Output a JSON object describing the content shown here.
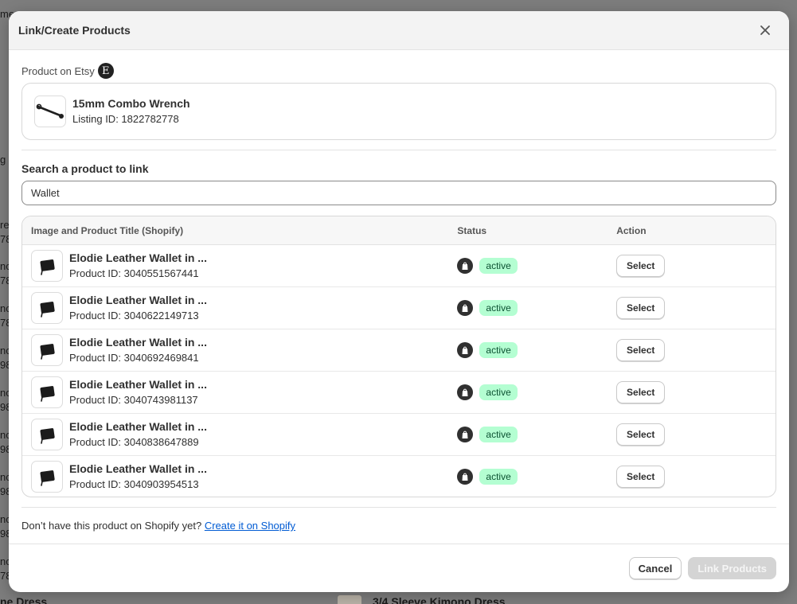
{
  "background": {
    "fragments": [
      "me",
      "g",
      "re",
      "78",
      "nc",
      "78",
      "nc",
      "78",
      "nc",
      "98",
      "nc",
      "98",
      "nc",
      "98",
      "nc",
      "98",
      "nc",
      "98",
      "nc",
      "78"
    ],
    "bottom_left_text": "ne Dress",
    "bottom_right_text": "3/4 Sleeve Kimono Dress"
  },
  "modal": {
    "title": "Link/Create Products",
    "etsy_section": {
      "label": "Product on Etsy",
      "badge_letter": "E",
      "product_title": "15mm Combo Wrench",
      "listing_id": "Listing ID: 1822782778"
    },
    "search": {
      "label": "Search a product to link",
      "value": "Wallet"
    },
    "table": {
      "headers": {
        "title": "Image and Product Title (Shopify)",
        "status": "Status",
        "action": "Action"
      },
      "rows": [
        {
          "title": "Elodie Leather Wallet in ...",
          "product_id": "Product ID: 3040551567441",
          "status": "active",
          "action": "Select"
        },
        {
          "title": "Elodie Leather Wallet in ...",
          "product_id": "Product ID: 3040622149713",
          "status": "active",
          "action": "Select"
        },
        {
          "title": "Elodie Leather Wallet in ...",
          "product_id": "Product ID: 3040692469841",
          "status": "active",
          "action": "Select"
        },
        {
          "title": "Elodie Leather Wallet in ...",
          "product_id": "Product ID: 3040743981137",
          "status": "active",
          "action": "Select"
        },
        {
          "title": "Elodie Leather Wallet in ...",
          "product_id": "Product ID: 3040838647889",
          "status": "active",
          "action": "Select"
        },
        {
          "title": "Elodie Leather Wallet in ...",
          "product_id": "Product ID: 3040903954513",
          "status": "active",
          "action": "Select"
        }
      ]
    },
    "create": {
      "prompt": "Don’t have this product on Shopify yet?",
      "link": "Create it on Shopify"
    },
    "footer": {
      "cancel": "Cancel",
      "link_products": "Link Products"
    }
  },
  "icons": {
    "close": "close-icon",
    "etsy": "etsy-icon",
    "shopify": "shopify-bag-icon",
    "wrench": "wrench-thumbnail",
    "wallet": "wallet-thumbnail"
  },
  "colors": {
    "status_bg": "#b4fed2",
    "status_text": "#0c5132",
    "link": "#005bd3",
    "disabled_button": "#d4d4d4"
  }
}
